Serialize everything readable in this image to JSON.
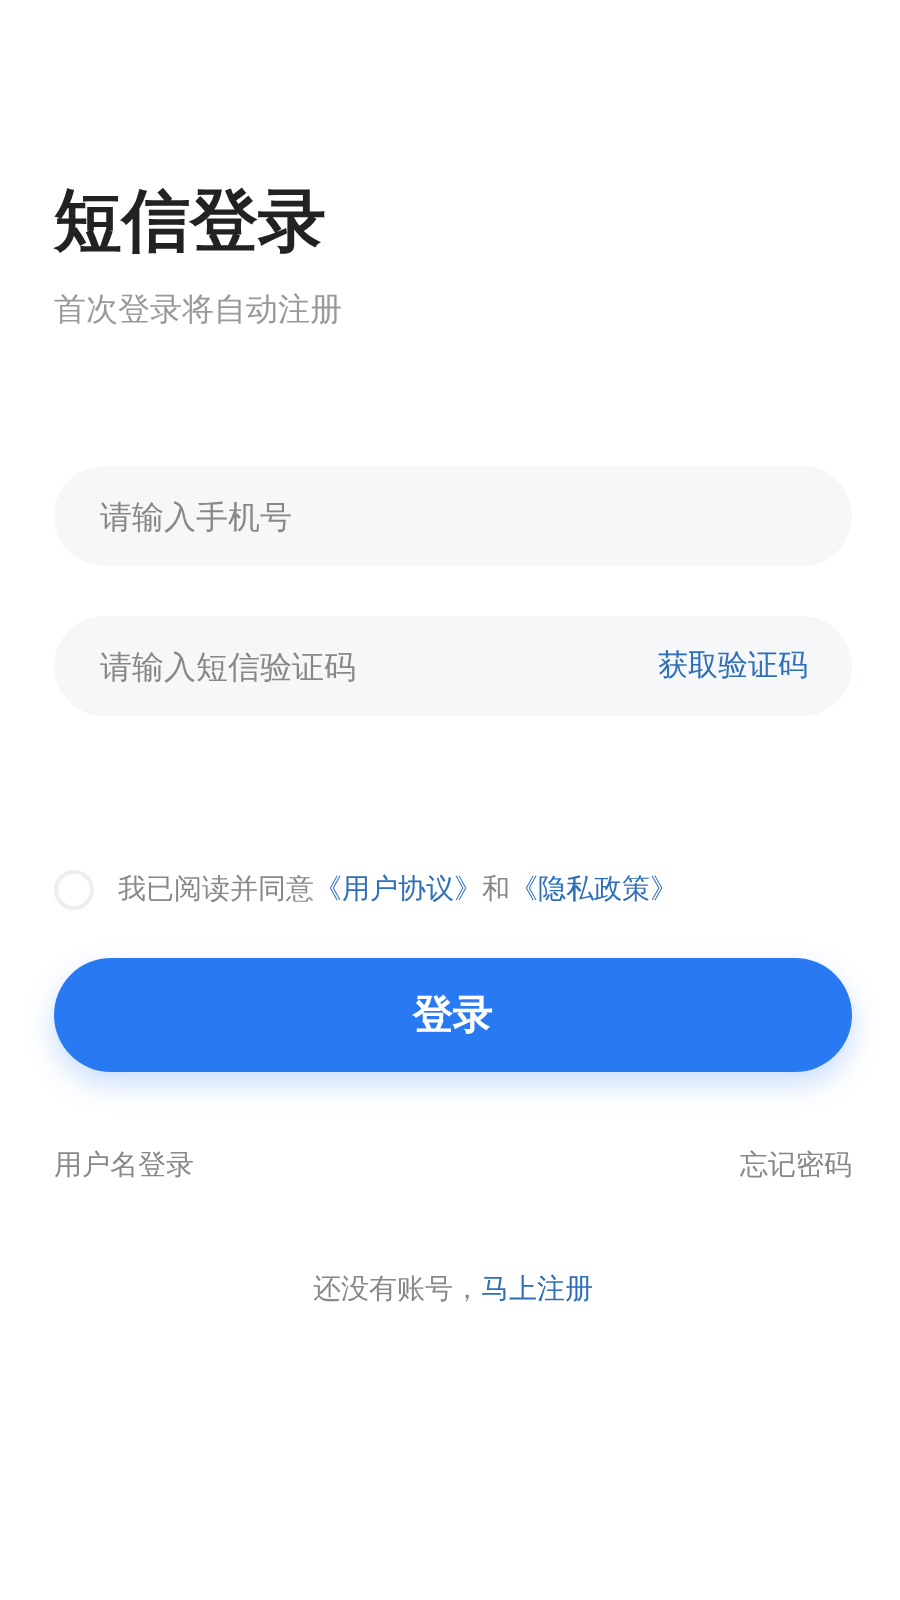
{
  "title": "短信登录",
  "subtitle": "首次登录将自动注册",
  "phone_field": {
    "placeholder": "请输入手机号"
  },
  "code_field": {
    "placeholder": "请输入短信验证码",
    "action": "获取验证码"
  },
  "agreement": {
    "checked": false,
    "prefix": "我已阅读并同意",
    "link_1": "《用户协议》",
    "joiner": "和",
    "link_2": "《隐私政策》"
  },
  "login_button": "登录",
  "alt_links": {
    "left": "用户名登录",
    "right": "忘记密码"
  },
  "register": {
    "prompt": "还没有账号，",
    "link": "马上注册"
  }
}
